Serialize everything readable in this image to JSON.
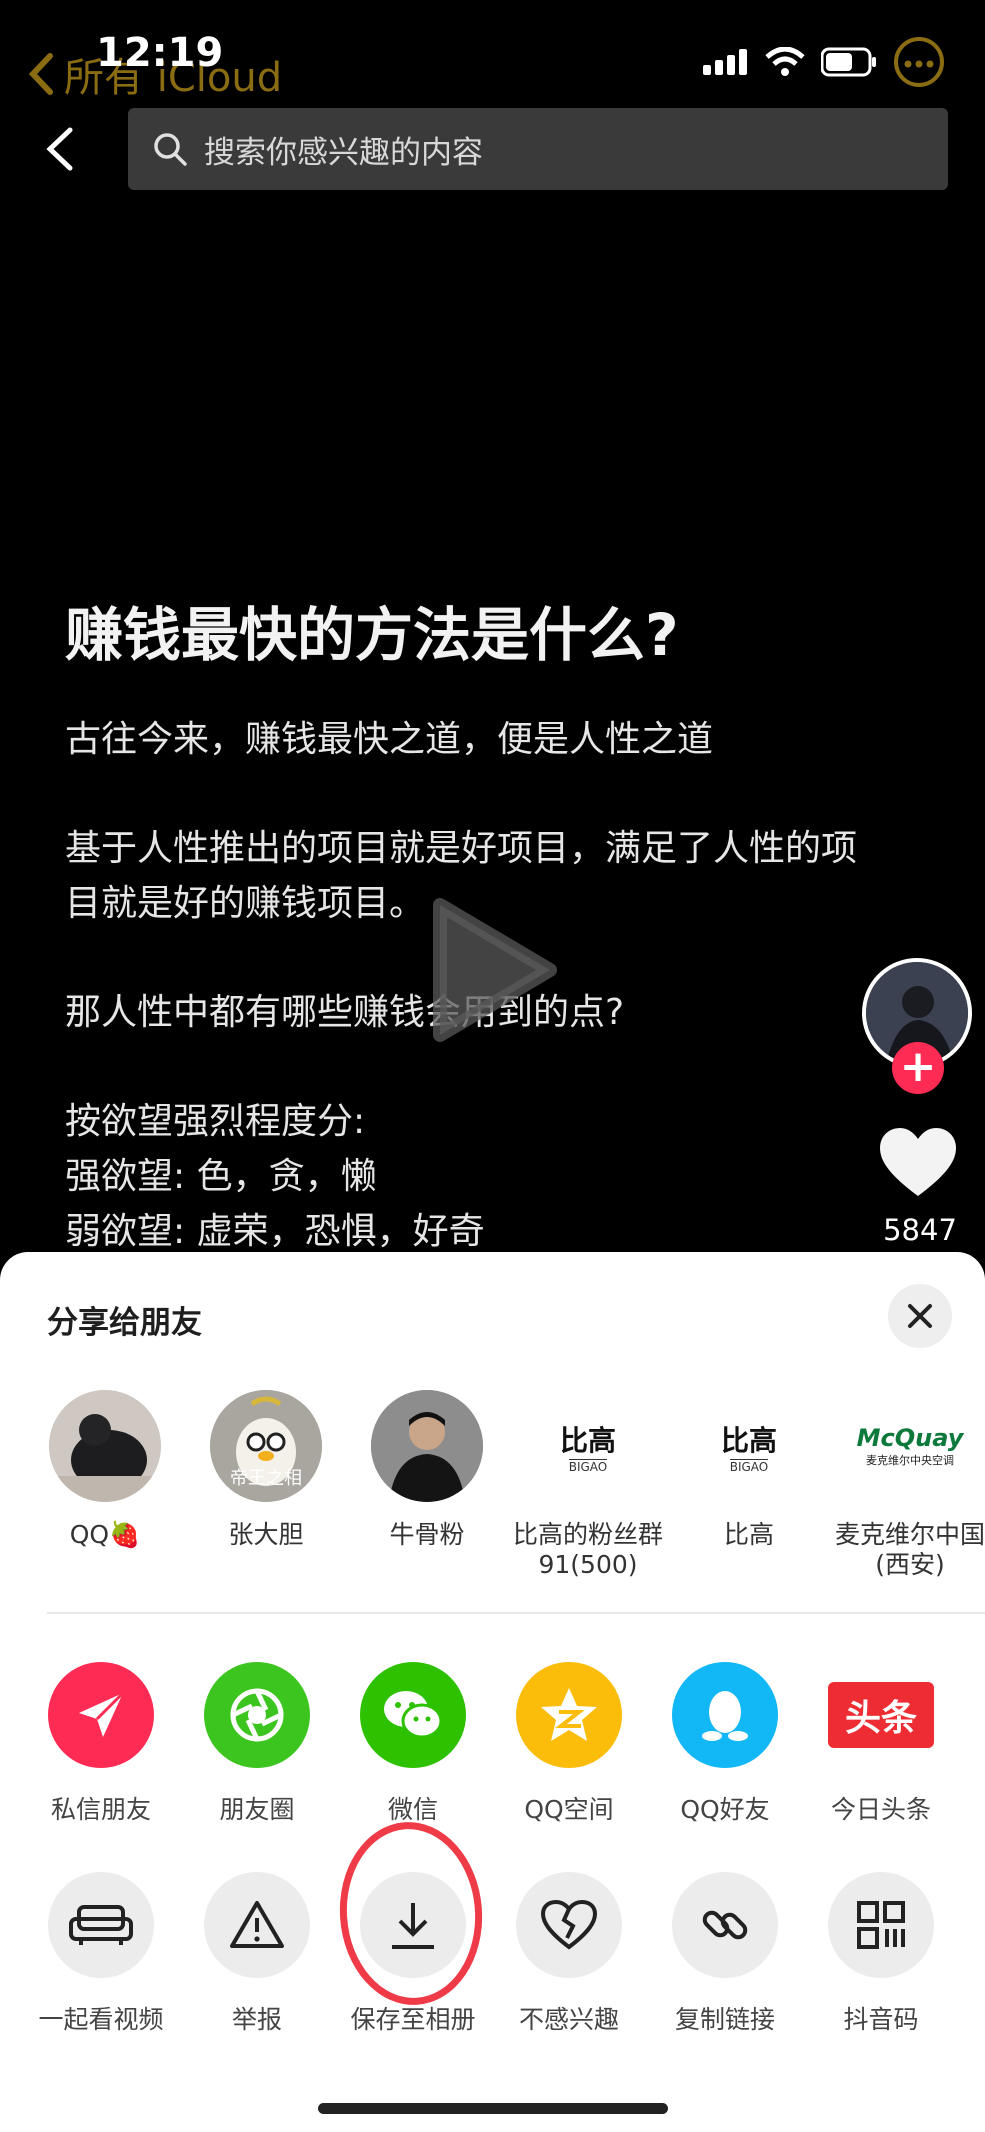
{
  "status_bar": {
    "time": "12:19",
    "back_app_label": "所有 iCloud"
  },
  "search": {
    "placeholder": "搜索你感兴趣的内容"
  },
  "article": {
    "title": "赚钱最快的方法是什么?",
    "para1": "古往今来，赚钱最快之道，便是人性之道",
    "para2a": "基于人性推出的项目就是好项目，满足了人性的项",
    "para2b": "目就是好的赚钱项目。",
    "para3": "那人性中都有哪些赚钱会用到的点?",
    "para4a": "按欲望强烈程度分:",
    "para4b": "强欲望: 色，贪，懒",
    "para4c": "弱欲望: 虚荣，恐惧，好奇"
  },
  "side_rail": {
    "like_count": "5847",
    "follow_symbol": "+"
  },
  "share_sheet": {
    "title": "分享给朋友",
    "friends": [
      {
        "name": "QQ🍓"
      },
      {
        "name": "张大胆",
        "overlay": "帝王之相"
      },
      {
        "name": "牛骨粉"
      },
      {
        "name": "比高的粉丝群 91(500)",
        "logo_main": "比高",
        "logo_sub": "BIGAO"
      },
      {
        "name": "比高",
        "logo_main": "比高",
        "logo_sub": "BIGAO"
      },
      {
        "name": "麦克维尔中国(西安)",
        "logo_main": "McQuay",
        "logo_sub": "麦克维尔中央空调"
      }
    ],
    "apps": [
      {
        "label": "私信朋友",
        "icon": "paper-plane-icon",
        "color": "#fe2c55"
      },
      {
        "label": "朋友圈",
        "icon": "moments-icon",
        "color": "#3cc51f"
      },
      {
        "label": "微信",
        "icon": "wechat-icon",
        "color": "#2dc100"
      },
      {
        "label": "QQ空间",
        "icon": "qzone-icon",
        "color": "#fbbd0a"
      },
      {
        "label": "QQ好友",
        "icon": "qq-icon",
        "color": "#12b7f5"
      },
      {
        "label": "今日头条",
        "icon": "toutiao-icon",
        "color": "#ed2d33",
        "icon_text": "头条"
      }
    ],
    "actions": [
      {
        "label": "一起看视频",
        "icon": "sofa-icon"
      },
      {
        "label": "举报",
        "icon": "warning-icon"
      },
      {
        "label": "保存至相册",
        "icon": "download-icon"
      },
      {
        "label": "不感兴趣",
        "icon": "broken-heart-icon"
      },
      {
        "label": "复制链接",
        "icon": "link-icon"
      },
      {
        "label": "抖音码",
        "icon": "qr-code-icon"
      }
    ]
  }
}
